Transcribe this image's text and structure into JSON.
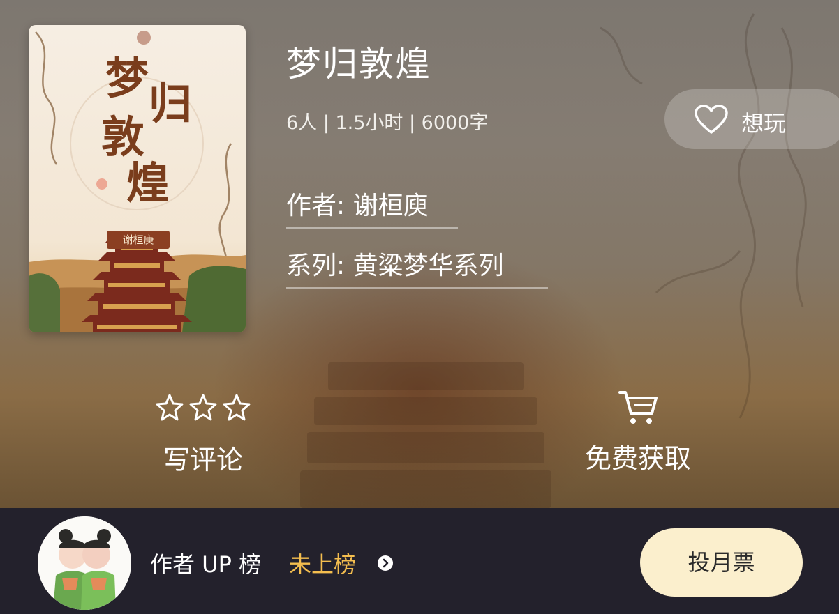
{
  "book": {
    "title": "梦归敦煌",
    "meta": "6人 | 1.5小时 | 6000字",
    "author_line": "作者: 谢桓庾",
    "series_line": "系列: 黄粱梦华系列",
    "cover": {
      "title_chars": [
        "梦",
        "归",
        "敦",
        "煌"
      ],
      "author": "谢桓庚"
    }
  },
  "actions": {
    "want_label": "想玩",
    "review_label": "写评论",
    "get_label": "免费获取"
  },
  "ranking": {
    "label": "作者 UP 榜",
    "status": "未上榜",
    "vote_label": "投月票"
  },
  "colors": {
    "bottom_bar": "#23212c",
    "rank_status": "#f4be4f",
    "vote_button": "#fbefcd"
  },
  "icons": {
    "want": "heart-outline-icon",
    "review": "star-outline-icon",
    "get": "cart-icon",
    "rank_more": "chevron-right-circle-icon"
  }
}
